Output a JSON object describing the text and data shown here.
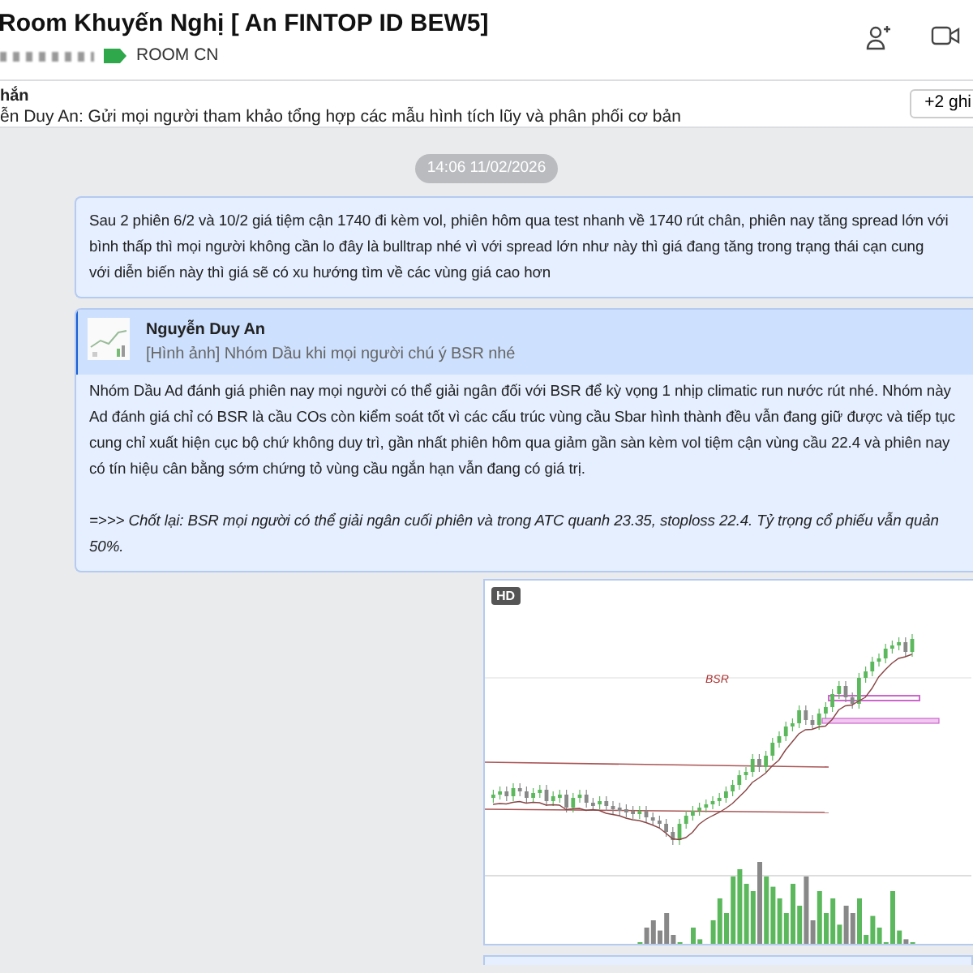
{
  "header": {
    "title": "Room Khuyến Nghị [ An FINTOP ID BEW5]",
    "tag": "ROOM CN"
  },
  "pinned": {
    "label": "hắn",
    "text": "ễn Duy An: Gửi mọi người tham khảo tổng hợp các mẫu hình tích lũy và phân phối cơ bản",
    "more_button": "+2 ghi"
  },
  "timestamp": "14:06 11/02/2026",
  "messages": [
    {
      "kind": "text",
      "lines": [
        "Sau 2 phiên 6/2 và 10/2 giá tiệm cận 1740 đi kèm vol, phiên hôm qua test nhanh về 1740 rút chân, phiên nay tăng spread lớn với",
        "bình thấp thì mọi người không cần lo đây là bulltrap nhé vì với spread lớn như này thì giá đang tăng trong trạng thái cạn cung",
        "với diễn biến này thì giá sẽ có xu hướng tìm về các vùng giá cao hơn"
      ]
    },
    {
      "kind": "reply",
      "quote": {
        "author": "Nguyễn Duy An",
        "text": "[Hình ảnh] Nhóm Dầu khi mọi người chú ý BSR nhé"
      },
      "lines": [
        "Nhóm Dầu Ad đánh giá phiên nay mọi người có thể giải ngân đối với BSR để kỳ vọng 1 nhịp climatic run nước rút nhé. Nhóm này",
        "Ad đánh giá chỉ có BSR là cầu COs còn kiểm soát tốt vì các cấu trúc vùng cầu Sbar hình thành đều vẫn đang giữ được và tiếp tục",
        "cung chỉ xuất hiện cục bộ chứ không duy trì, gần nhất phiên hôm qua giảm gần sàn kèm vol tiệm cận vùng cầu 22.4 và phiên nay",
        "có tín hiệu cân bằng sớm chứng tỏ vùng cầu ngắn hạn vẫn đang có giá trị."
      ],
      "conclusion": [
        "=>>> Chốt lại: BSR mọi người có thể giải ngân cuối phiên và trong ATC quanh 23.35, stoploss 22.4. Tỷ trọng cổ phiếu vẫn quản",
        "50%."
      ]
    },
    {
      "badge": "HD",
      "chart_label": "BSR"
    }
  ]
}
